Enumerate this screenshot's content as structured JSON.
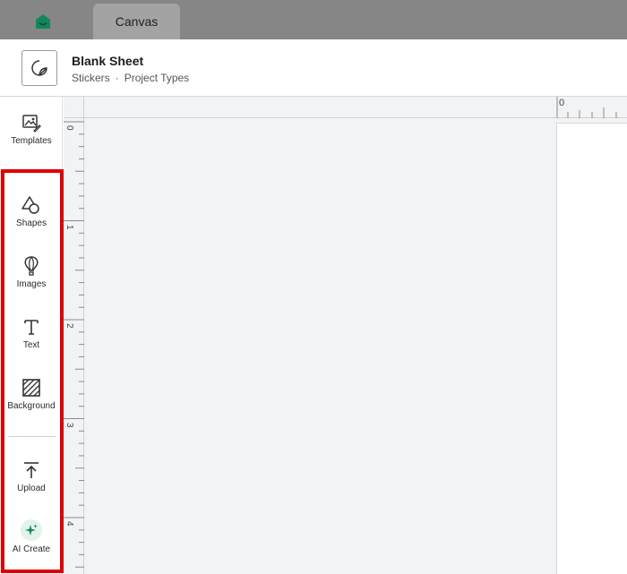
{
  "topbar": {
    "home_icon": "home-icon",
    "active_tab": "Canvas"
  },
  "project": {
    "title": "Blank Sheet",
    "breadcrumb": [
      "Stickers",
      "Project Types"
    ],
    "separator": "·"
  },
  "sidebar": {
    "items": [
      {
        "label": "Templates",
        "icon": "templates-icon"
      },
      {
        "label": "Shapes",
        "icon": "shapes-icon"
      },
      {
        "label": "Images",
        "icon": "balloon-icon"
      },
      {
        "label": "Text",
        "icon": "text-icon"
      },
      {
        "label": "Background",
        "icon": "background-icon"
      },
      {
        "label": "Upload",
        "icon": "upload-icon"
      },
      {
        "label": "AI Create",
        "icon": "sparkle-icon"
      }
    ]
  },
  "rulers": {
    "vertical_labels": [
      "0",
      "1",
      "2",
      "3",
      "4"
    ],
    "horizontal_labels": [
      "0"
    ]
  },
  "colors": {
    "brand_green": "#11875a",
    "highlight_red": "#e00000",
    "topbar_gray": "#868686",
    "tab_gray": "#a3a3a3"
  }
}
